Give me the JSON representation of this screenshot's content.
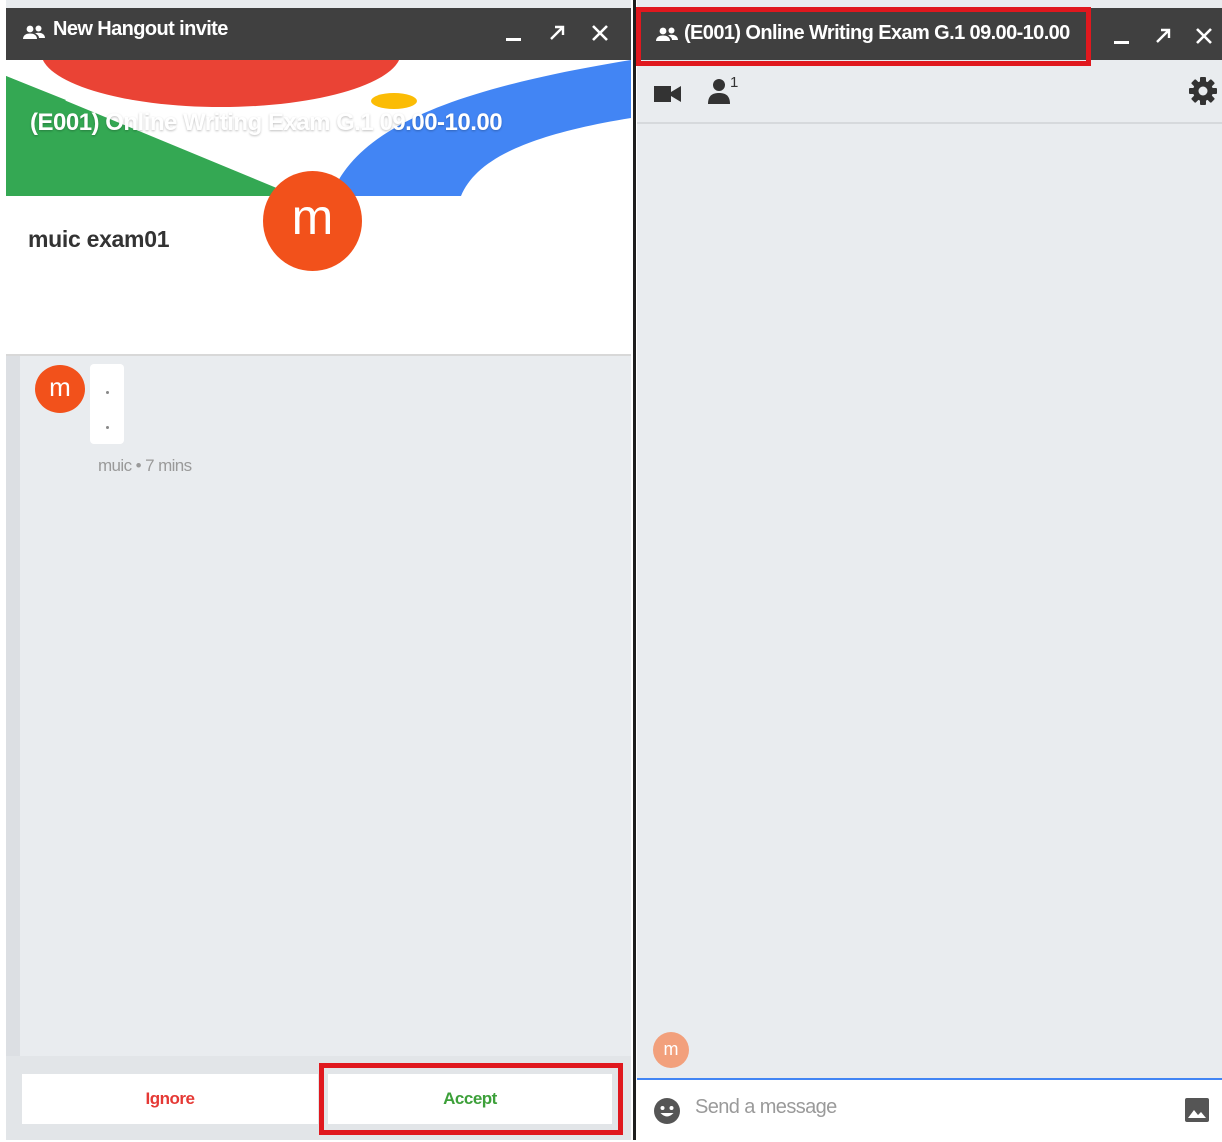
{
  "invite_window": {
    "title": "New Hangout invite",
    "controls": [
      "minimize",
      "pop-out",
      "close"
    ],
    "banner_title": "(E001) Online Writing Exam G.1 09.00-10.00",
    "host_avatar_letter": "m",
    "host_name": "muic exam01",
    "message": {
      "avatar_letter": "m",
      "meta": "muic • 7 mins"
    },
    "ignore_label": "Ignore",
    "accept_label": "Accept",
    "accent_colors": {
      "red": "#ea4335",
      "green": "#34a853",
      "blue": "#4285f4",
      "yellow": "#fbbc05",
      "avatar": "#f2511b",
      "highlight": "#e0181e"
    }
  },
  "chat_window": {
    "title": "(E001) Online Writing Exam G.1 09.00-10.00",
    "controls": [
      "minimize",
      "pop-out",
      "close"
    ],
    "toolbar": {
      "video_icon": "video-camera-icon",
      "participants_count": "1",
      "settings_icon": "gear-icon"
    },
    "avatar_letter": "m",
    "compose_placeholder": "Send a message",
    "emoji_icon": "emoji-icon",
    "image_icon": "image-icon"
  }
}
